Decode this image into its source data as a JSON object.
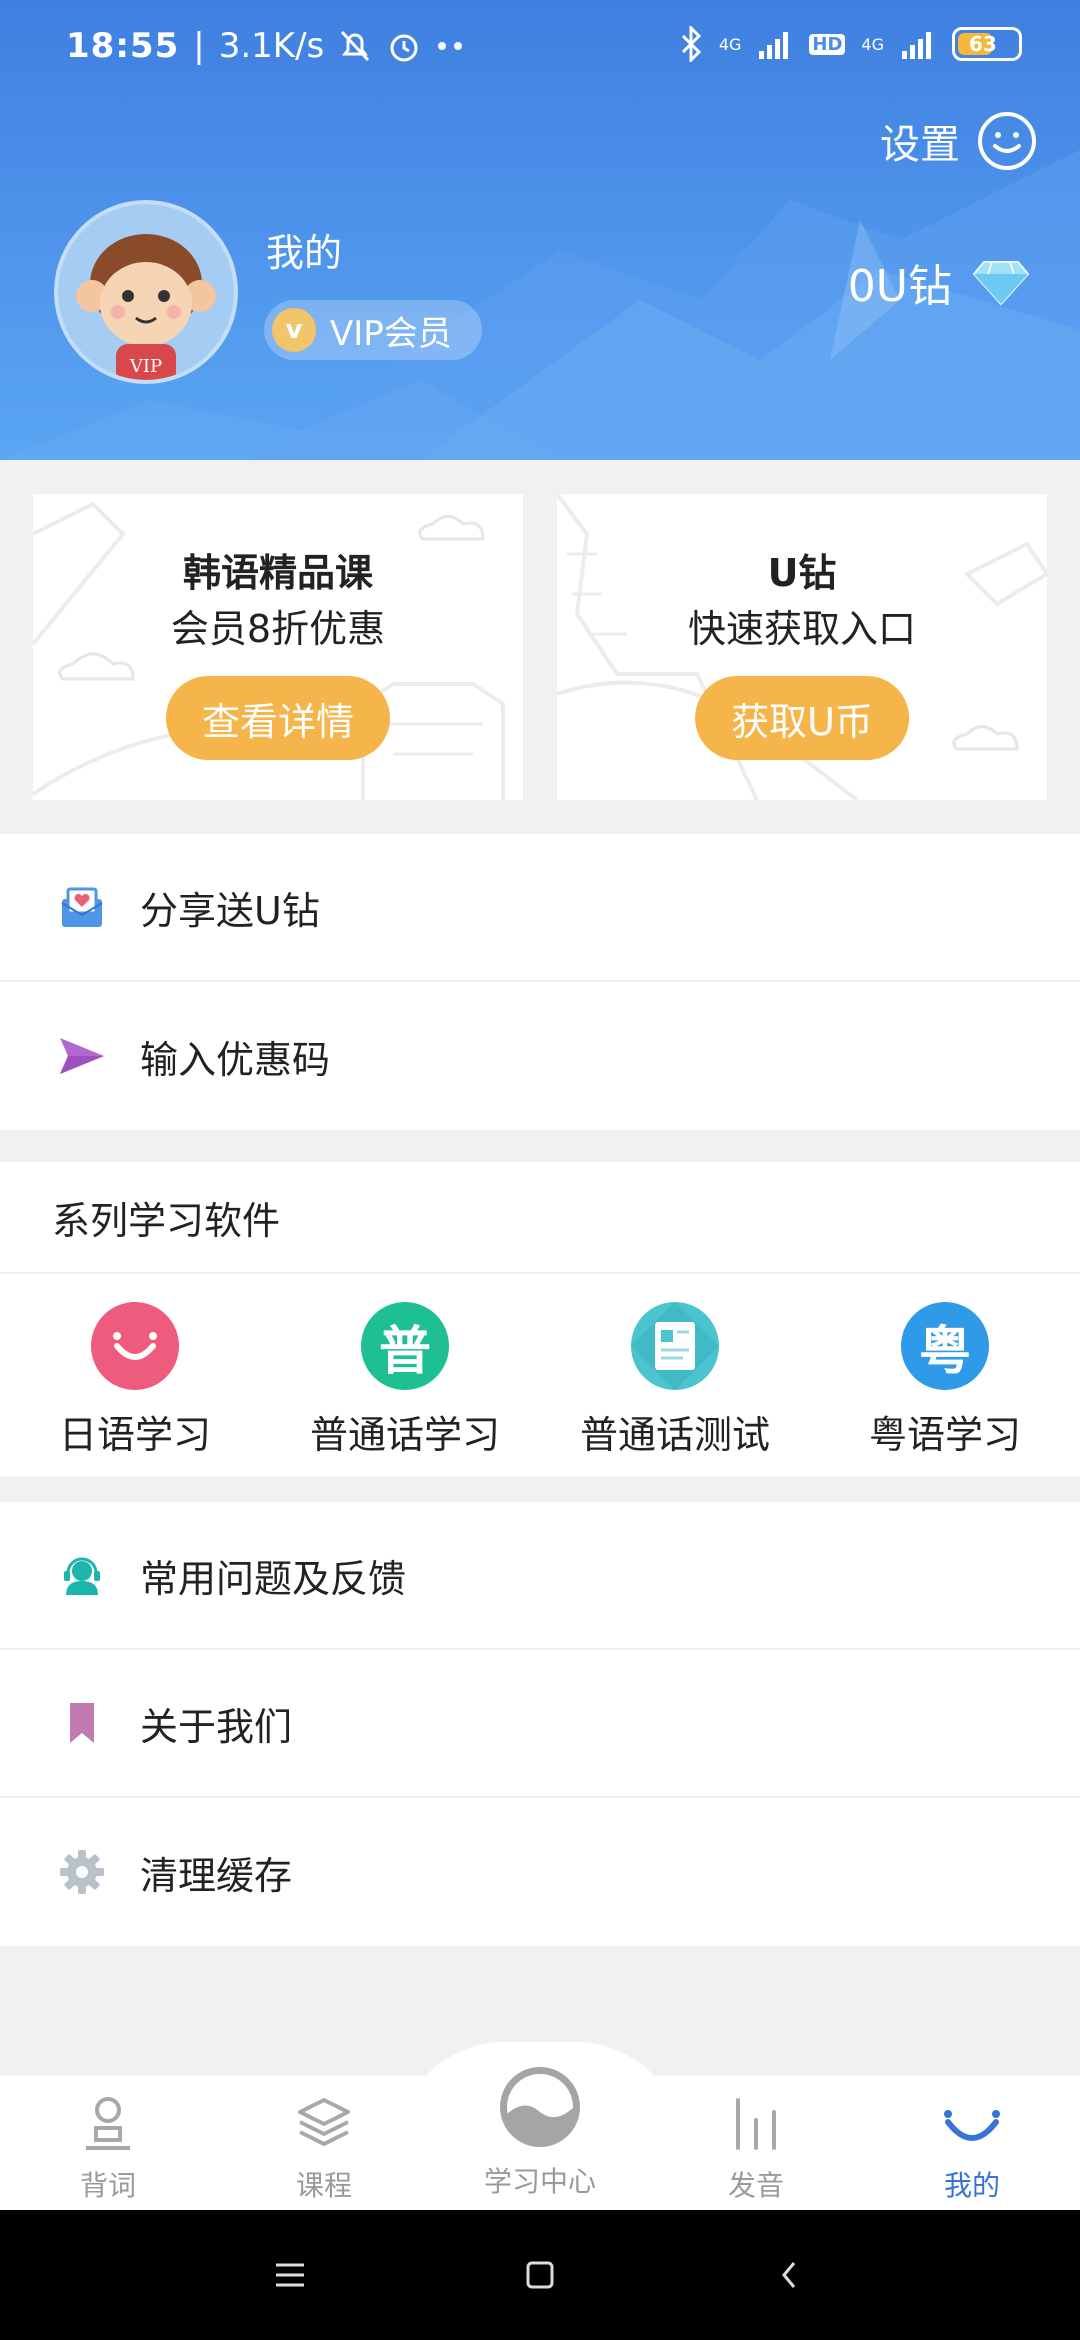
{
  "status_bar": {
    "time": "18:55",
    "network_speed": "3.1K/s",
    "signal_label_1": "4G",
    "hd_label": "HD",
    "signal_label_2": "4G",
    "battery": "63",
    "battery_level": 0.63
  },
  "header": {
    "settings_label": "设置",
    "user_name": "我的",
    "vip_badge": "VIP会员",
    "vip_coin_letter": "v",
    "avatar_badge": "VIP",
    "diamond_count": "0U钻"
  },
  "promos": [
    {
      "title": "韩语精品课",
      "subtitle": "会员8折优惠",
      "button": "查看详情"
    },
    {
      "title": "U钻",
      "subtitle": "快速获取入口",
      "button": "获取U币"
    }
  ],
  "menu_top": [
    {
      "label": "分享送U钻",
      "icon": "gift-mail-icon"
    },
    {
      "label": "输入优惠码",
      "icon": "send-icon"
    }
  ],
  "apps": {
    "header": "系列学习软件",
    "items": [
      {
        "label": "日语学习",
        "icon": "smile-icon",
        "color": "#ef5b7c",
        "glyph": ""
      },
      {
        "label": "普通话学习",
        "icon": "pu-icon",
        "color": "#1fbf94",
        "glyph": "普"
      },
      {
        "label": "普通话测试",
        "icon": "test-paper-icon",
        "color": "#4cc4cf",
        "glyph": ""
      },
      {
        "label": "粤语学习",
        "icon": "yue-icon",
        "color": "#2f9ae8",
        "glyph": "粤"
      }
    ]
  },
  "menu_bottom": [
    {
      "label": "常用问题及反馈",
      "icon": "support-icon"
    },
    {
      "label": "关于我们",
      "icon": "bookmark-icon"
    },
    {
      "label": "清理缓存",
      "icon": "gear-icon"
    }
  ],
  "tabs": [
    {
      "label": "背词",
      "icon": "word-icon",
      "active": false
    },
    {
      "label": "课程",
      "icon": "layers-icon",
      "active": false
    },
    {
      "label": "学习中心",
      "icon": "study-center-icon",
      "active": false
    },
    {
      "label": "发音",
      "icon": "bars-icon",
      "active": false
    },
    {
      "label": "我的",
      "icon": "smile-icon",
      "active": true
    }
  ],
  "colors": {
    "header_blue": "#4a8ee8",
    "accent_orange": "#f5b54a",
    "active_tab": "#3b72d8"
  }
}
